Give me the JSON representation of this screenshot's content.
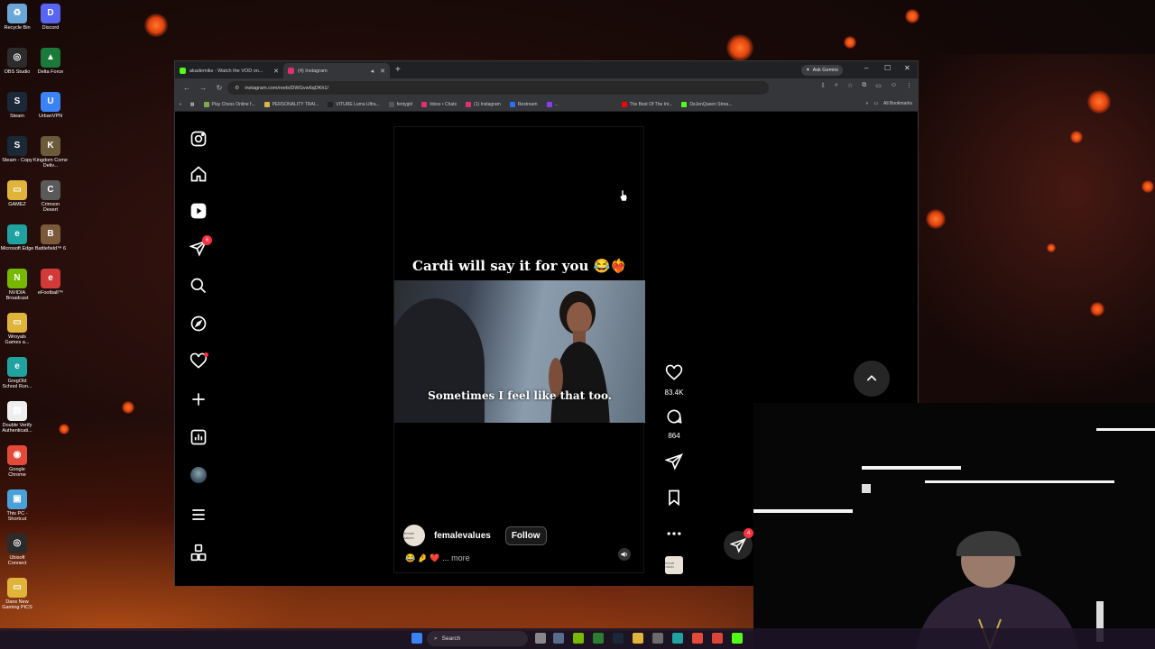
{
  "desktop": {
    "icons": [
      {
        "label": "Recycle Bin",
        "color": "#6aa7d8",
        "glyph": "♻"
      },
      {
        "label": "Discord",
        "color": "#5865f2",
        "glyph": "D"
      },
      {
        "label": "OBS Studio",
        "color": "#2c2c2c",
        "glyph": "◎"
      },
      {
        "label": "Delta Force",
        "color": "#1b7a3a",
        "glyph": "▲"
      },
      {
        "label": "Steam",
        "color": "#1b2838",
        "glyph": "S"
      },
      {
        "label": "UrbanVPN",
        "color": "#3b82f6",
        "glyph": "U"
      },
      {
        "label": "Steam - Copy",
        "color": "#1b2838",
        "glyph": "S"
      },
      {
        "label": "Kingdom Come Deliv...",
        "color": "#6b5a3c",
        "glyph": "K"
      },
      {
        "label": "GAMEZ",
        "color": "#e0b33a",
        "glyph": "▭"
      },
      {
        "label": "Crimson Desert",
        "color": "#5a5a5a",
        "glyph": "C"
      },
      {
        "label": "Microsoft Edge",
        "color": "#1fa3a0",
        "glyph": "e"
      },
      {
        "label": "Battlefield™ 6",
        "color": "#7a5a3a",
        "glyph": "B"
      },
      {
        "label": "NVIDIA Broadcast",
        "color": "#76b900",
        "glyph": "N"
      },
      {
        "label": "eFootball™",
        "color": "#d23a3a",
        "glyph": "e"
      },
      {
        "label": "Wroyals Games a...",
        "color": "#e0b33a",
        "glyph": "▭"
      },
      {
        "label": "GregOld School Run...",
        "color": "#1fa3a0",
        "glyph": "e"
      },
      {
        "label": "Double Verify Authenticati...",
        "color": "#eeeeee",
        "glyph": "▤"
      },
      {
        "label": "Google Chrome",
        "color": "#e24a3a",
        "glyph": "◉"
      },
      {
        "label": "This PC - Shortcut",
        "color": "#4aa0d8",
        "glyph": "▣"
      },
      {
        "label": "Ubisoft Connect",
        "color": "#2b2b2b",
        "glyph": "◎"
      },
      {
        "label": "Dans New Gaming PICS",
        "color": "#e0b33a",
        "glyph": "▭"
      }
    ]
  },
  "browser": {
    "tabs": [
      {
        "title": "akademiks - Watch the VOD on...",
        "favicon_color": "#53fc18",
        "active": false
      },
      {
        "title": "(4) Instagram",
        "favicon_color": "#e1306c",
        "active": true
      }
    ],
    "ask_gemini": "Ask Gemini",
    "url": "instagram.com/reels/DWGvw6qDKh1/",
    "bookmarks": [
      {
        "label": "Play Chess Online f...",
        "color": "#7fa650"
      },
      {
        "label": "PERSONALITY TRAI...",
        "color": "#d9b34a"
      },
      {
        "label": "VITURE Luma Ultra...",
        "color": "#222222"
      },
      {
        "label": "fentygirl",
        "color": "#555555"
      },
      {
        "label": "Inbox • Chats",
        "color": "#e1306c"
      },
      {
        "label": "(1) Instagram",
        "color": "#e1306c"
      },
      {
        "label": "Restream",
        "color": "#2a6ff0"
      },
      {
        "label": "...",
        "color": "#8a3cf0"
      },
      {
        "label": "The Best Of The Int...",
        "color": "#ff0000"
      },
      {
        "label": "DeJenQueen Strea...",
        "color": "#53fc18"
      }
    ],
    "all_bookmarks": "All Bookmarks"
  },
  "instagram": {
    "sidebar_badges": {
      "notifications": "6"
    },
    "reel": {
      "caption": "Cardi will say it for you 😂❤️‍🔥",
      "subtitle": "Sometimes I feel like that too.",
      "author": "femalevalues",
      "avatar_text": "female values",
      "follow_label": "Follow",
      "description_emojis": "😂 🤌 ❤️ ...",
      "more_label": "more"
    },
    "actions": {
      "likes": "83.4K",
      "comments": "864"
    },
    "share_badge": "4"
  },
  "taskbar": {
    "search_label": "Search"
  },
  "colors": {
    "accent_red": "#ff3040",
    "tab_bg": "#35363a",
    "frame_bg": "#202124"
  }
}
